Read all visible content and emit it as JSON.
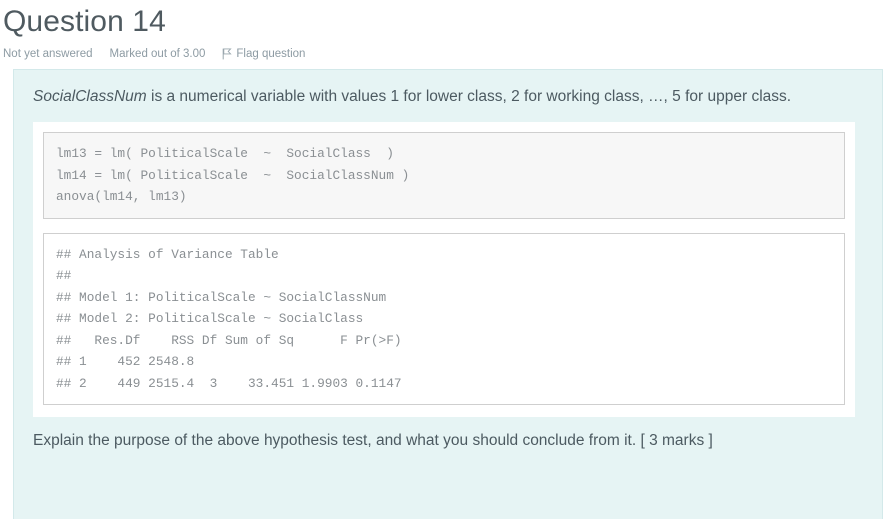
{
  "header": {
    "title": "Question 14",
    "status": "Not yet answered",
    "marks": "Marked out of 3.00",
    "flag_label": "Flag question",
    "flag_icon": "flag-icon"
  },
  "question": {
    "intro_emphasis": "SocialClassNum",
    "intro_rest": " is a numerical variable with values 1 for lower class, 2 for working class, …, 5 for upper class.",
    "code_input": "lm13 = lm( PoliticalScale  ~  SocialClass  )\nlm14 = lm( PoliticalScale  ~  SocialClassNum )\nanova(lm14, lm13)",
    "code_output": "## Analysis of Variance Table\n##\n## Model 1: PoliticalScale ~ SocialClassNum\n## Model 2: PoliticalScale ~ SocialClass\n##   Res.Df    RSS Df Sum of Sq      F Pr(>F)\n## 1    452 2548.8\n## 2    449 2515.4  3    33.451 1.9903 0.1147",
    "prompt": "Explain the purpose of the above hypothesis test, and what you should conclude from it. [ 3 marks ]"
  },
  "anova_table": {
    "title": "Analysis of Variance Table",
    "model_1": "PoliticalScale ~ SocialClassNum",
    "model_2": "PoliticalScale ~ SocialClass",
    "columns": [
      "Res.Df",
      "RSS",
      "Df",
      "Sum of Sq",
      "F",
      "Pr(>F)"
    ],
    "rows": [
      {
        "row": "1",
        "Res.Df": "452",
        "RSS": "2548.8",
        "Df": "",
        "Sum of Sq": "",
        "F": "",
        "Pr(>F)": ""
      },
      {
        "row": "2",
        "Res.Df": "449",
        "RSS": "2515.4",
        "Df": "3",
        "Sum of Sq": "33.451",
        "F": "1.9903",
        "Pr(>F)": "0.1147"
      }
    ]
  },
  "colors": {
    "panel_background": "#e6f4f4",
    "panel_border": "#d3e9ea",
    "code_input_background": "#f7f7f7",
    "code_border": "#cfcfcf",
    "body_text": "#4c5a61",
    "meta_text": "#8d9ba3",
    "code_text": "#8a8f93"
  }
}
